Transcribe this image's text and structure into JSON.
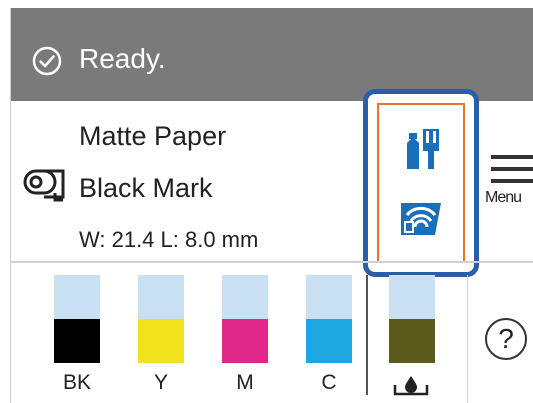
{
  "status": {
    "text": "Ready.",
    "icon": "check-circle-icon"
  },
  "media": {
    "type": "Matte Paper",
    "mark": "Black Mark",
    "size": "W: 21.4 L: 8.0 mm",
    "icon": "paper-roll-icon"
  },
  "highlight_buttons": {
    "maintenance_icon": "maintenance-icon",
    "wifi_icon": "wifi-icon"
  },
  "menu": {
    "label": "Menu",
    "icon": "hamburger-icon"
  },
  "inks": [
    {
      "label": "BK",
      "color": "#000000",
      "level": 0.5
    },
    {
      "label": "Y",
      "color": "#f2e21c",
      "level": 0.5
    },
    {
      "label": "M",
      "color": "#e0288a",
      "level": 0.5
    },
    {
      "label": "C",
      "color": "#1ea6e0",
      "level": 0.5
    }
  ],
  "maintenance_box": {
    "color": "#5a5a1c",
    "level": 0.5,
    "icon": "ink-drop-tray-icon"
  },
  "help": {
    "label": "?"
  }
}
